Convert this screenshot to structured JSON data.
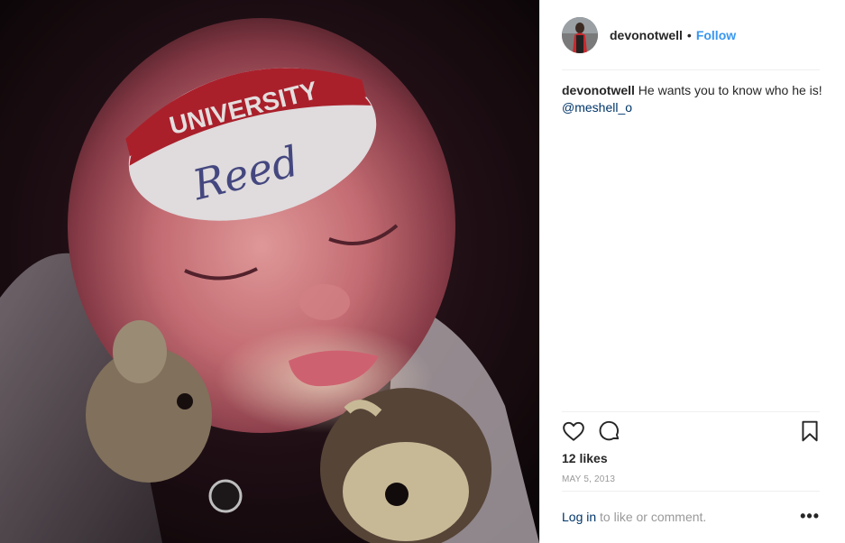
{
  "post": {
    "username": "devonotwell",
    "follow_label": "Follow",
    "separator": "•",
    "caption": {
      "username": "devonotwell",
      "text": "He wants you to know who he is!",
      "mention": "@meshell_o"
    },
    "likes": "12 likes",
    "date": "MAY 5, 2013",
    "comment_login": "Log in",
    "comment_rest": "to like or comment.",
    "more_label": "•••"
  },
  "photo": {
    "sticker_top": "UNIVERSITY",
    "sticker_name": "Reed"
  },
  "icons": {
    "like": "heart-icon",
    "comment": "comment-bubble-icon",
    "save": "bookmark-icon",
    "more": "more-options-icon"
  },
  "colors": {
    "link": "#3897f0",
    "mention": "#003569",
    "text": "#262626",
    "muted": "#999999",
    "sticker_band": "#b8232f"
  }
}
